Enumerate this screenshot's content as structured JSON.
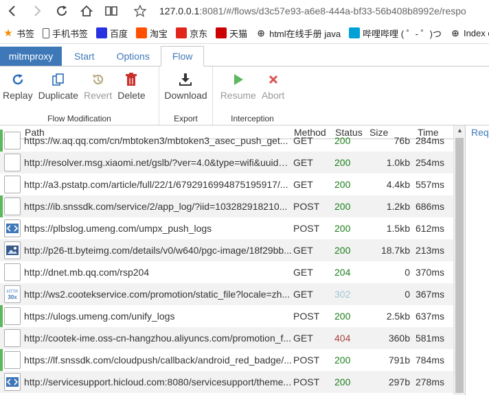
{
  "browser": {
    "url_host": "127.0.0.1",
    "url_rest": ":8081/#/flows/d3c57e93-a6e8-444a-bf33-56b408b8992e/respo",
    "bookmarks": [
      {
        "label": "书签",
        "icon": "star-icon",
        "color": "#f28c00"
      },
      {
        "label": "手机书签",
        "icon": "phone-icon",
        "color": "#555555"
      },
      {
        "label": "百度",
        "icon": "baidu-icon",
        "color": "#2932e1"
      },
      {
        "label": "淘宝",
        "icon": "taobao-icon",
        "color": "#ff5000"
      },
      {
        "label": "京东",
        "icon": "jd-icon",
        "color": "#e1251b"
      },
      {
        "label": "天猫",
        "icon": "tmall-icon",
        "color": "#cc0000"
      },
      {
        "label": "html在线手册 java",
        "icon": "globe-icon",
        "color": "#444444"
      },
      {
        "label": "哔哩哔哩 ( ゜- ゜)つ",
        "icon": "bilibili-icon",
        "color": "#00a1d6"
      },
      {
        "label": "Index o",
        "icon": "globe-icon",
        "color": "#444444"
      }
    ]
  },
  "app": {
    "brand": "mitmproxy",
    "tabs": [
      "Start",
      "Options",
      "Flow"
    ],
    "active_tab": "Flow"
  },
  "ribbon": {
    "groups": [
      {
        "title": "Flow Modification",
        "buttons": [
          {
            "label": "Replay",
            "icon": "refresh-icon",
            "enabled": true
          },
          {
            "label": "Duplicate",
            "icon": "copy-icon",
            "enabled": true
          },
          {
            "label": "Revert",
            "icon": "history-icon",
            "enabled": false
          },
          {
            "label": "Delete",
            "icon": "trash-icon",
            "enabled": true
          }
        ]
      },
      {
        "title": "Export",
        "buttons": [
          {
            "label": "Download",
            "icon": "download-icon",
            "enabled": true
          }
        ]
      },
      {
        "title": "Interception",
        "buttons": [
          {
            "label": "Resume",
            "icon": "play-icon",
            "enabled": false
          },
          {
            "label": "Abort",
            "icon": "x-icon",
            "enabled": false
          }
        ]
      }
    ]
  },
  "table": {
    "headers": {
      "path": "Path",
      "method": "Method",
      "status": "Status",
      "size": "Size",
      "time": "Time"
    },
    "rows": [
      {
        "path": "https://w.aq.qq.com/cn/mbtoken3/mbtoken3_asec_push_get...",
        "method": "GET",
        "status": "200",
        "size": "76b",
        "time": "284ms",
        "icon": "plain",
        "mark": "#5cb85c"
      },
      {
        "path": "http://resolver.msg.xiaomi.net/gslb/?ver=4.0&type=wifi&uuid=...",
        "method": "GET",
        "status": "200",
        "size": "1.0kb",
        "time": "254ms",
        "icon": "plain",
        "mark": ""
      },
      {
        "path": "http://a3.pstatp.com/article/full/22/1/6792916994875195917/...",
        "method": "GET",
        "status": "200",
        "size": "4.4kb",
        "time": "557ms",
        "icon": "plain",
        "mark": ""
      },
      {
        "path": "https://ib.snssdk.com/service/2/app_log/?iid=103282918210...",
        "method": "POST",
        "status": "200",
        "size": "1.2kb",
        "time": "686ms",
        "icon": "plain",
        "mark": "#5cb85c"
      },
      {
        "path": "https://plbslog.umeng.com/umpx_push_logs",
        "method": "POST",
        "status": "200",
        "size": "1.5kb",
        "time": "612ms",
        "icon": "code",
        "mark": ""
      },
      {
        "path": "http://p26-tt.byteimg.com/details/v0/w640/pgc-image/18f29bb...",
        "method": "GET",
        "status": "200",
        "size": "18.7kb",
        "time": "213ms",
        "icon": "image",
        "mark": ""
      },
      {
        "path": "http://dnet.mb.qq.com/rsp204",
        "method": "GET",
        "status": "204",
        "size": "0",
        "time": "370ms",
        "icon": "plain",
        "mark": ""
      },
      {
        "path": "http://ws2.cootekservice.com/promotion/static_file?locale=zh...",
        "method": "GET",
        "status": "302",
        "size": "0",
        "time": "367ms",
        "icon": "redirect",
        "mark": ""
      },
      {
        "path": "https://ulogs.umeng.com/unify_logs",
        "method": "POST",
        "status": "200",
        "size": "2.5kb",
        "time": "637ms",
        "icon": "plain",
        "mark": "#5cb85c"
      },
      {
        "path": "http://cootek-ime.oss-cn-hangzhou.aliyuncs.com/promotion_f...",
        "method": "GET",
        "status": "404",
        "size": "360b",
        "time": "581ms",
        "icon": "plain",
        "mark": ""
      },
      {
        "path": "https://lf.snssdk.com/cloudpush/callback/android_red_badge/...",
        "method": "POST",
        "status": "200",
        "size": "791b",
        "time": "784ms",
        "icon": "plain",
        "mark": "#5cb85c"
      },
      {
        "path": "http://servicesupport.hicloud.com:8080/servicesupport/theme...",
        "method": "POST",
        "status": "200",
        "size": "297b",
        "time": "278ms",
        "icon": "code",
        "mark": ""
      }
    ]
  },
  "status_colors": {
    "200": "#1a7f1a",
    "204": "#1a7f1a",
    "302": "#9fc7d6",
    "404": "#a94442"
  },
  "detail": {
    "tab": "Req"
  }
}
